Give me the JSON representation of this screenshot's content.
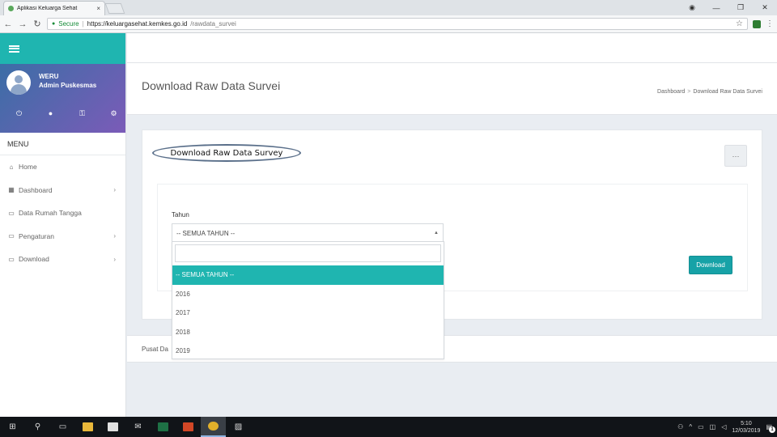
{
  "browser": {
    "tab_title": "Aplikasi Keluarga Sehat",
    "tab_close": "×",
    "secure_label": "Secure",
    "url_host": "https://keluargasehat.kemkes.go.id",
    "url_path": "/rawdata_survei"
  },
  "sidebar": {
    "user_name": "WERU",
    "user_role": "Admin Puskesmas",
    "menu_header": "MENU",
    "items": [
      {
        "label": "Home",
        "icon": "home-icon",
        "has_chevron": false
      },
      {
        "label": "Dashboard",
        "icon": "dashboard-icon",
        "has_chevron": true
      },
      {
        "label": "Data Rumah Tangga",
        "icon": "folder-icon",
        "has_chevron": false
      },
      {
        "label": "Pengaturan",
        "icon": "folder-icon",
        "has_chevron": true
      },
      {
        "label": "Download",
        "icon": "folder-icon",
        "has_chevron": true
      }
    ]
  },
  "header": {
    "page_title": "Download Raw Data Survei",
    "breadcrumb": [
      "Dashboard",
      "Download Raw Data Survei"
    ],
    "breadcrumb_sep": ">"
  },
  "card": {
    "title": "Download Raw Data Survey",
    "menu_label": "···",
    "field_label": "Tahun",
    "selected_value": "-- SEMUA TAHUN --",
    "download_label": "Download"
  },
  "dropdown": {
    "options": [
      "-- SEMUA TAHUN --",
      "2016",
      "2017",
      "2018",
      "2019"
    ],
    "selected_index": 0
  },
  "footer": {
    "text": "Pusat Da"
  },
  "taskbar": {
    "time": "5:10",
    "date": "12/03/2019",
    "notification_count": "1"
  },
  "colors": {
    "accent": "#1fb5b0",
    "button": "#17a2a7",
    "sidebar_gradient": [
      "#3b6ea6",
      "#7b5bb8"
    ]
  }
}
